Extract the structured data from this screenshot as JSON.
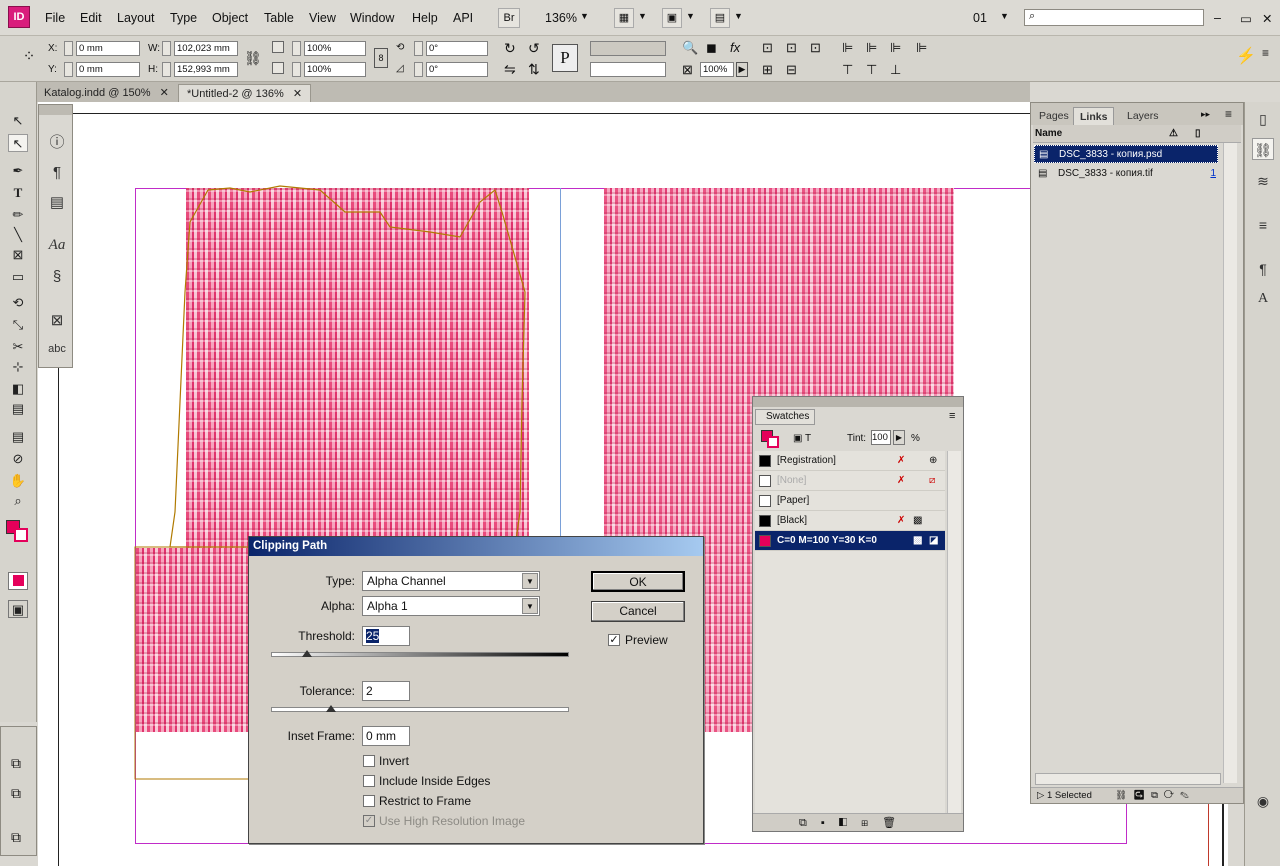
{
  "app": {
    "logo": "ID"
  },
  "menu": [
    "File",
    "Edit",
    "Layout",
    "Type",
    "Object",
    "Table",
    "View",
    "Window",
    "Help",
    "API"
  ],
  "menubar": {
    "bridge": "Br",
    "zoom": "136%",
    "page_number": "01"
  },
  "control": {
    "x_label": "X:",
    "x": "0 mm",
    "y_label": "Y:",
    "y": "0 mm",
    "w_label": "W:",
    "w": "102,023 mm",
    "h_label": "H:",
    "h": "152,993 mm",
    "scale_x": "100%",
    "scale_y": "100%",
    "rotate": "0°",
    "shear": "0°",
    "opacity": "100%"
  },
  "doc_tabs": [
    {
      "label": "Katalog.indd @ 150%"
    },
    {
      "label": "*Untitled-2 @ 136%"
    }
  ],
  "links_panel": {
    "tabs": [
      "Pages",
      "Links",
      "Layers"
    ],
    "active_tab": "Links",
    "col_name": "Name",
    "rows": [
      {
        "name": "DSC_3833 - копия.psd",
        "page": "",
        "selected": true
      },
      {
        "name": "DSC_3833 - копия.tif",
        "page": "1",
        "selected": false
      }
    ],
    "status": "1 Selected"
  },
  "swatches": {
    "title": "Swatches",
    "tint_label": "Tint:",
    "tint": "100",
    "percent": "%",
    "rows": [
      {
        "name": "[Registration]",
        "color": "#000000"
      },
      {
        "name": "[None]",
        "color": "#ffffff"
      },
      {
        "name": "[Paper]",
        "color": "#ffffff"
      },
      {
        "name": "[Black]",
        "color": "#000000"
      },
      {
        "name": "C=0 M=100 Y=30 K=0",
        "color": "#e4005a"
      }
    ]
  },
  "dialog": {
    "title": "Clipping Path",
    "type_label": "Type:",
    "type_value": "Alpha Channel",
    "alpha_label": "Alpha:",
    "alpha_value": "Alpha 1",
    "threshold_label": "Threshold:",
    "threshold": "25",
    "threshold_level": 0.12,
    "tolerance_label": "Tolerance:",
    "tolerance": "2",
    "tolerance_level": 0.2,
    "inset_label": "Inset Frame:",
    "inset": "0 mm",
    "invert": "Invert",
    "include_inside": "Include Inside Edges",
    "restrict": "Restrict to Frame",
    "high_res": "Use High Resolution Image",
    "ok": "OK",
    "cancel": "Cancel",
    "preview": "Preview"
  },
  "colors": {
    "accent_magenta": "#e4005a",
    "title_bar": "#0a246a"
  }
}
